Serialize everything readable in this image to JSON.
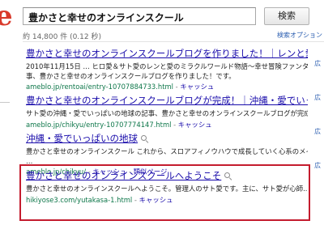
{
  "logo_fragment": "e",
  "search": {
    "query": "豊かさと幸せのオンラインスクール",
    "button_label": "検索"
  },
  "stats": {
    "text": "約 14,800 件 (0.12 秒)",
    "options_label": "検索オプション"
  },
  "results": [
    {
      "title": "豊かさと幸せのオンラインスクールブログを作りました！｜レンと愛の ...",
      "snippet_lines": [
        "2010年11月15日 … ヒロ愛＆サト愛のレンと愛のミラクルワールド物語〜幸せ冒険ファンタジーの記",
        "事、豊かさと幸せのオンラインスクールブログを作りました！です。"
      ],
      "url": "ameblo.jp/rentoai/entry-10707884733.html",
      "cache": "キャッシュ",
      "similar": ""
    },
    {
      "title": "豊かさと幸せのオンラインスクールブログが完成！｜沖縄・愛でいっぱい ...",
      "snippet_lines": [
        "サト愛の沖縄・愛でいっぱいの地球の記事、豊かさと幸せのオンラインスクールブログが完成！です。"
      ],
      "url": "ameblo.jp/chikyu/entry-10707774147.html",
      "cache": "キャッシュ",
      "similar": ""
    },
    {
      "title": "沖縄・愛でいっぱいの地球",
      "snippet_lines": [
        "豊かさと幸せのオンラインスクール これから、スロアフィノウハウで成長していく心系のメインブログ",
        "…"
      ],
      "url": "ameblo.jp/chikyu/",
      "cache": "キャッシュ",
      "similar": "類似ページ"
    },
    {
      "title": "豊かさと幸せのオンラインスクールへようこそ",
      "snippet_lines": [
        "豊かさと幸せのオンラインスクールへようこそ。管理人のサト愛です。主に、サト愛が心師..."
      ],
      "url": "hikiyose3.com/yutakasa-1.html",
      "cache": "キャッシュ",
      "similar": ""
    }
  ],
  "right_edge_items": [
    "広",
    "広",
    "広",
    "広"
  ],
  "highlight_color": "#c41c2e",
  "link_color": "#1a0dab",
  "url_color": "#0e774a"
}
